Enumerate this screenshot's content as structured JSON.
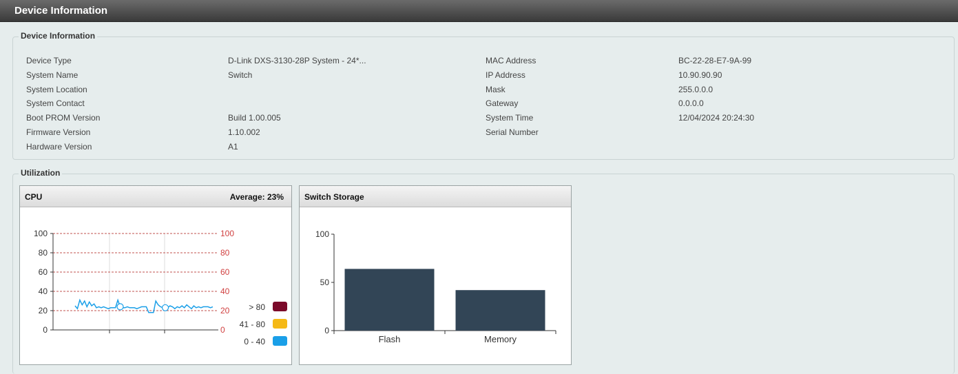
{
  "page": {
    "title": "Device Information"
  },
  "device_info": {
    "legend": "Device Information",
    "left": [
      {
        "label": "Device Type",
        "value": "D-Link DXS-3130-28P System - 24*..."
      },
      {
        "label": "System Name",
        "value": "Switch"
      },
      {
        "label": "System Location",
        "value": ""
      },
      {
        "label": "System Contact",
        "value": ""
      },
      {
        "label": "Boot PROM Version",
        "value": "Build 1.00.005"
      },
      {
        "label": "Firmware Version",
        "value": "1.10.002"
      },
      {
        "label": "Hardware Version",
        "value": "A1"
      }
    ],
    "right": [
      {
        "label": "MAC Address",
        "value": "BC-22-28-E7-9A-99"
      },
      {
        "label": "IP Address",
        "value": "10.90.90.90"
      },
      {
        "label": "Mask",
        "value": "255.0.0.0"
      },
      {
        "label": "Gateway",
        "value": "0.0.0.0"
      },
      {
        "label": "System Time",
        "value": "12/04/2024 20:24:30"
      },
      {
        "label": "Serial Number",
        "value": ""
      }
    ]
  },
  "utilization": {
    "legend": "Utilization",
    "cpu": {
      "title": "CPU",
      "average": "Average: 23%",
      "legend": [
        {
          "label": "> 80",
          "color": "#7b0a2a"
        },
        {
          "label": "41 - 80",
          "color": "#f5b916"
        },
        {
          "label": "0 - 40",
          "color": "#1a9fe8"
        }
      ]
    },
    "storage": {
      "title": "Switch Storage"
    }
  },
  "chart_data": [
    {
      "type": "line",
      "title": "CPU",
      "ylim": [
        0,
        100
      ],
      "yticks": [
        "0",
        "20",
        "40",
        "60",
        "80",
        "100"
      ],
      "grid": true,
      "series": [
        {
          "color": "#1a9fe8",
          "values": [
            25,
            22,
            31,
            26,
            30,
            24,
            29,
            25,
            27,
            23,
            24,
            23,
            24,
            23,
            22,
            23,
            23,
            23,
            31,
            24,
            23,
            23,
            24,
            23,
            23,
            23,
            22,
            23,
            24,
            24,
            24,
            18,
            18,
            18,
            30,
            26,
            24,
            23,
            23,
            23,
            25,
            24,
            22,
            24,
            23,
            25,
            23,
            26,
            24,
            22,
            25,
            23,
            24,
            23,
            24,
            24,
            24,
            23,
            24
          ]
        }
      ]
    },
    {
      "type": "bar",
      "title": "Switch Storage",
      "categories": [
        "Flash",
        "Memory"
      ],
      "values": [
        64,
        42
      ],
      "ylim": [
        0,
        100
      ],
      "yticks": [
        "0",
        "50",
        "100"
      ],
      "color": "#324556"
    }
  ]
}
